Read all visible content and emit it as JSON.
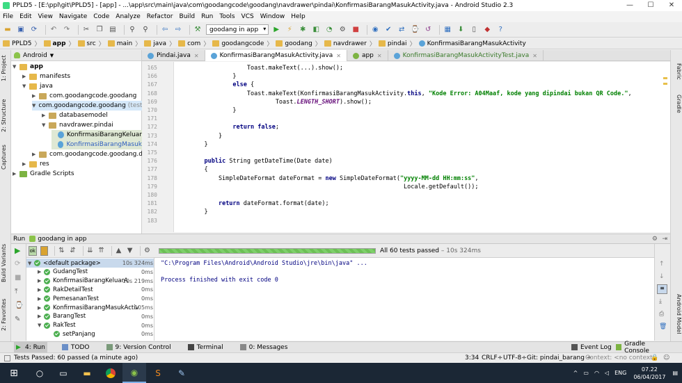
{
  "window": {
    "title": "PPLD5 - [E:\\ppl\\git\\PPLD5] - [app] - ...\\app\\src\\main\\java\\com\\goodangcode\\goodang\\navdrawer\\pindai\\KonfirmasiBarangMasukActivity.java - Android Studio 2.3",
    "minimize": "—",
    "maximize": "☐",
    "close": "✕"
  },
  "menu": [
    "File",
    "Edit",
    "View",
    "Navigate",
    "Code",
    "Analyze",
    "Refactor",
    "Build",
    "Run",
    "Tools",
    "VCS",
    "Window",
    "Help"
  ],
  "toolbar": {
    "run_config": "goodang in app"
  },
  "breadcrumb": [
    "PPLD5",
    "app",
    "src",
    "main",
    "java",
    "com",
    "goodangcode",
    "goodang",
    "navdrawer",
    "pindai",
    "KonfirmasiBarangMasukActivity"
  ],
  "left_strip": [
    "1: Project",
    "2: Structure",
    "Captures",
    "Build Variants",
    "2: Favorites"
  ],
  "right_strip": [
    "Fabric",
    "Gradle",
    "Android Model"
  ],
  "project": {
    "view": "Android",
    "tree": [
      {
        "label": "app",
        "bold": true
      },
      {
        "label": "manifests"
      },
      {
        "label": "java"
      },
      {
        "label": "com.goodangcode.goodang"
      },
      {
        "label": "com.goodangcode.goodang",
        "suffix": "(test)"
      },
      {
        "label": "databasemodel"
      },
      {
        "label": "navdrawer.pindai"
      },
      {
        "label": "KonfirmasiBarangKeluar"
      },
      {
        "label": "KonfirmasiBarangMasuk"
      },
      {
        "label": "com.goodangcode.goodang.datab"
      },
      {
        "label": "res"
      },
      {
        "label": "Gradle Scripts"
      }
    ]
  },
  "tabs": [
    "Pindai.java",
    "KonfirmasiBarangMasukActivity.java",
    "app",
    "KonfirmasiBarangMasukActivityTest.java"
  ],
  "code": {
    "line_numbers": [
      "165",
      "166",
      "167",
      "168",
      "169",
      "170",
      "171",
      "172",
      "173",
      "174",
      "175",
      "176",
      "177",
      "178",
      "179",
      "180",
      "181",
      "182",
      "183"
    ],
    "lines": [
      "                Toast.makeText(...).show();",
      "            }",
      "            else {",
      "                Toast.makeText(KonfirmasiBarangMasukActivity.this, \"Kode Error: A04Maaf, kode yang dipindai bukan QR Code.\",",
      "                        Toast.LENGTH_SHORT).show();",
      "            }",
      "",
      "            return false;",
      "        }",
      "    }",
      "",
      "    public String getDateTime(Date date)",
      "    {",
      "        SimpleDateFormat dateFormat = new SimpleDateFormat(\"yyyy-MM-dd HH:mm:ss\",",
      "                                                            Locale.getDefault());",
      "",
      "        return dateFormat.format(date);",
      "    }",
      ""
    ]
  },
  "run": {
    "title": "Run",
    "config": "goodang in app",
    "progress": 1.0,
    "summary": "All 60 tests passed",
    "summary_time": "– 10s 324ms",
    "tests": [
      {
        "name": "<default package>",
        "time": "10s 324ms"
      },
      {
        "name": "GudangTest",
        "time": "0ms"
      },
      {
        "name": "KonfirmasiBarangKeluarA",
        "time": "10s 219ms"
      },
      {
        "name": "RakDetailTest",
        "time": "0ms"
      },
      {
        "name": "PemesananTest",
        "time": "0ms"
      },
      {
        "name": "KonfirmasiBarangMasukActiv",
        "time": "105ms"
      },
      {
        "name": "BarangTest",
        "time": "0ms"
      },
      {
        "name": "RakTest",
        "time": "0ms"
      },
      {
        "name": "setPanjang",
        "time": "0ms"
      }
    ],
    "console": [
      "\"C:\\Program Files\\Android\\Android Studio\\jre\\bin\\java\" ...",
      "",
      "Process finished with exit code 0"
    ]
  },
  "tool_tabs": [
    "4: Run",
    "TODO",
    "9: Version Control",
    "Terminal",
    "0: Messages",
    "Event Log",
    "Gradle Console"
  ],
  "status": {
    "message": "Tests Passed: 60 passed (a minute ago)",
    "position": "3:34",
    "line_sep": "CRLF÷",
    "encoding": "UTF-8÷",
    "git": "Git: pindai_barang ÷",
    "context": "Context: <no context>"
  },
  "taskbar": {
    "time": "07.22",
    "date": "06/04/2017",
    "lang": "ENG"
  }
}
